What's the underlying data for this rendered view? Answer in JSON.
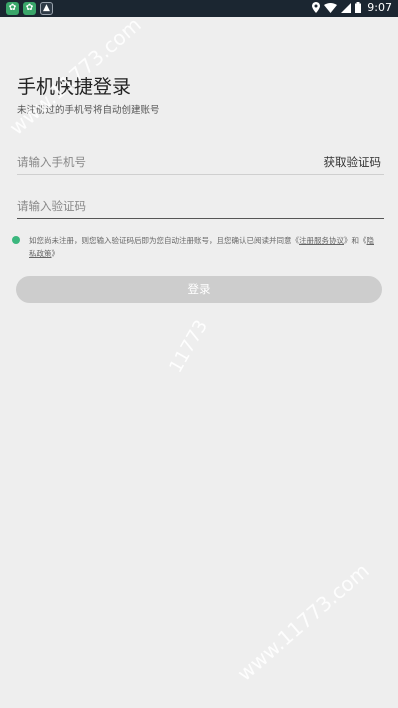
{
  "status_bar": {
    "time": "9:07",
    "icons": [
      "location-icon",
      "wifi-icon",
      "signal-icon",
      "battery-icon"
    ]
  },
  "login": {
    "title": "手机快捷登录",
    "subtitle": "未注册过的手机号将自动创建账号",
    "phone_placeholder": "请输入手机号",
    "get_code_label": "获取验证码",
    "code_placeholder": "请输入验证码",
    "agreement_prefix": "如您尚未注册，则您输入验证码后即为您自动注册账号，且您确认已阅读并同意《",
    "service_link": "注册服务协议",
    "agreement_mid": "》和《",
    "privacy_link": "隐私政策",
    "agreement_suffix": "》",
    "login_button": "登录"
  },
  "watermark": {
    "text_full": "www.11773.com",
    "text_short": "11773"
  },
  "colors": {
    "status_bar": "#1b2631",
    "background": "#eeeeee",
    "check": "#3bb77e",
    "button_disabled": "#cdcdcd"
  }
}
